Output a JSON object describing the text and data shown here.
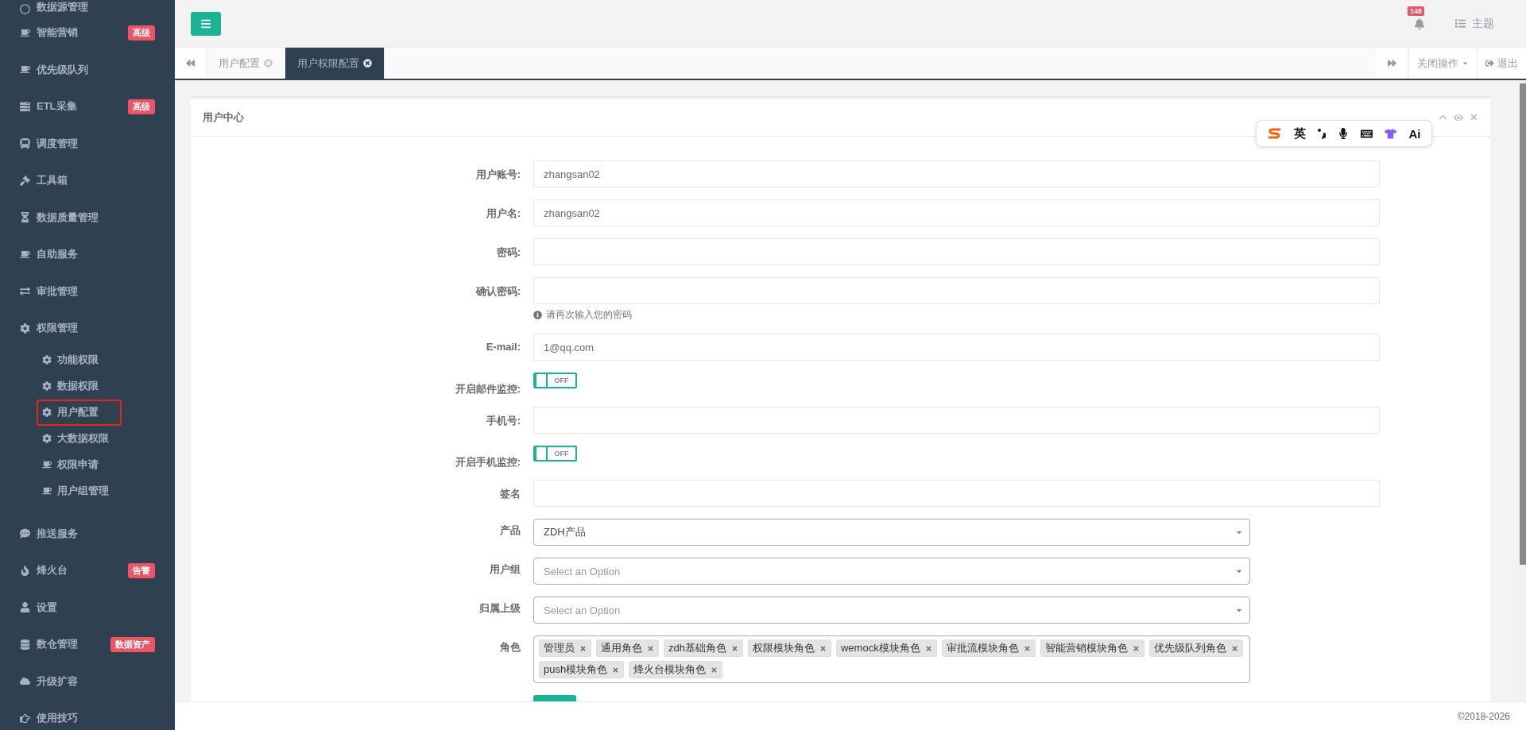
{
  "sidebar": {
    "items": [
      {
        "label": "数据源管理"
      },
      {
        "label": "智能营销",
        "badge": "高级"
      },
      {
        "label": "优先级队列"
      },
      {
        "label": "ETL采集",
        "badge": "高级"
      },
      {
        "label": "调度管理"
      },
      {
        "label": "工具箱"
      },
      {
        "label": "数据质量管理"
      },
      {
        "label": "自助服务"
      },
      {
        "label": "审批管理"
      },
      {
        "label": "权限管理",
        "children": [
          {
            "label": "功能权限",
            "outlined": false
          },
          {
            "label": "数据权限",
            "outlined": false
          },
          {
            "label": "用户配置",
            "outlined": true
          },
          {
            "label": "大数据权限",
            "outlined": false
          },
          {
            "label": "权限申请",
            "outlined": false
          },
          {
            "label": "用户组管理",
            "outlined": false
          }
        ]
      },
      {
        "label": "推送服务"
      },
      {
        "label": "烽火台",
        "badge": "告警"
      },
      {
        "label": "设置"
      },
      {
        "label": "数仓管理",
        "badge": "数据资产"
      },
      {
        "label": "升级扩容"
      },
      {
        "label": "使用技巧"
      }
    ]
  },
  "header": {
    "notification_count": "148",
    "theme_label": "主题"
  },
  "tabs": [
    {
      "label": "用户配置",
      "selected": false
    },
    {
      "label": "用户权限配置",
      "selected": true
    }
  ],
  "tab_actions": {
    "close_menu": "关闭操作",
    "logout": "退出"
  },
  "card": {
    "title": "用户中心"
  },
  "ime_toolbar": {
    "language": "英",
    "ai": "Ai"
  },
  "form": {
    "fields": [
      {
        "kind": "input",
        "label": "用户账号:",
        "value": "zhangsan02"
      },
      {
        "kind": "input",
        "label": "用户名:",
        "value": "zhangsan02"
      },
      {
        "kind": "input",
        "label": "密码:"
      },
      {
        "kind": "input",
        "label": "确认密码:",
        "help": "请再次输入您的密码"
      },
      {
        "kind": "input",
        "label": "E-mail:",
        "value": "1@qq.com"
      },
      {
        "kind": "toggle",
        "label": "开启邮件监控:",
        "on": false,
        "state_label": "OFF"
      },
      {
        "kind": "input",
        "label": "手机号:"
      },
      {
        "kind": "toggle",
        "label": "开启手机监控:",
        "on": false,
        "state_label": "OFF"
      },
      {
        "kind": "input",
        "label": "签名"
      },
      {
        "kind": "select",
        "label": "产品",
        "value": "ZDH产品"
      },
      {
        "kind": "select",
        "label": "用户组",
        "placeholder": "Select an Option"
      },
      {
        "kind": "select",
        "label": "归属上级",
        "placeholder": "Select an Option"
      },
      {
        "kind": "tags",
        "label": "角色",
        "tags": [
          "管理员",
          "通用角色",
          "zdh基础角色",
          "权限模块角色",
          "wemock模块角色",
          "审批流模块角色",
          "智能营销模块角色",
          "优先级队列角色",
          "push模块角色",
          "烽火台模块角色"
        ]
      }
    ]
  },
  "footer": {
    "copyright": "©2018-2026"
  }
}
